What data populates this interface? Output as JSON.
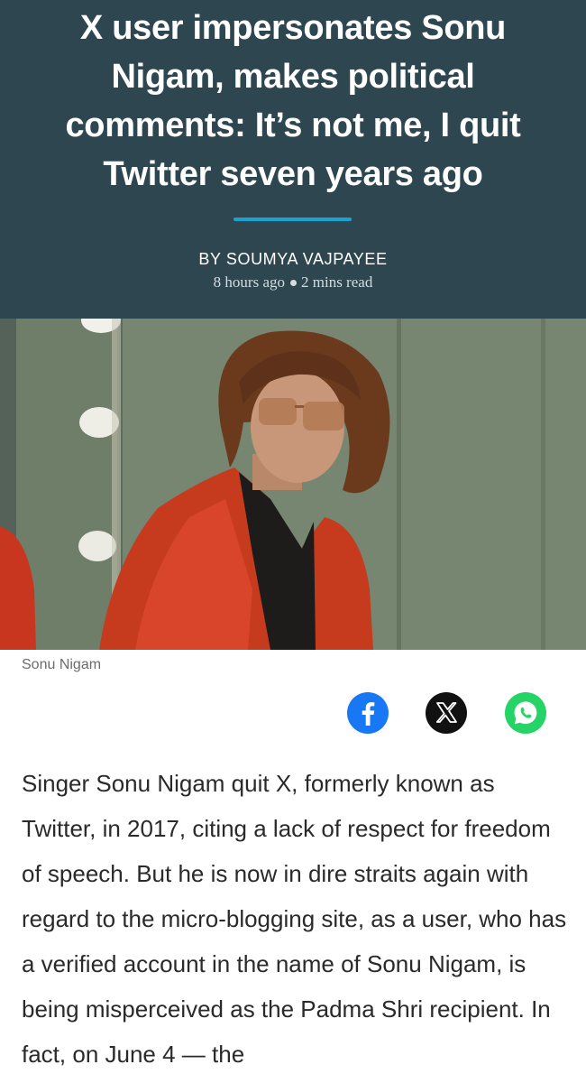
{
  "article": {
    "headline": "X user impersonates Sonu Nigam, makes political comments: It’s not me, I quit Twitter seven years ago",
    "byline": "BY SOUMYA VAJPAYEE",
    "posted": "8 hours ago",
    "read_time": "2 mins read",
    "image_caption": "Sonu Nigam",
    "body": "Singer Sonu Nigam quit X, formerly known as Twitter, in 2017, citing a lack of respect for freedom of speech. But he is now in dire straits again with regard to the micro-blogging site, as a user, who has a verified account in the name of Sonu Nigam, is being misperceived as the Padma Shri recipient. In fact, on June 4 — the"
  },
  "share": {
    "buttons": [
      {
        "icon": "facebook-icon",
        "color": "#1877f2"
      },
      {
        "icon": "x-icon",
        "color": "#111111"
      },
      {
        "icon": "whatsapp-icon",
        "color": "#25d366"
      }
    ]
  },
  "colors": {
    "header_bg": "#2e4650",
    "accent": "#1aa3cf"
  }
}
